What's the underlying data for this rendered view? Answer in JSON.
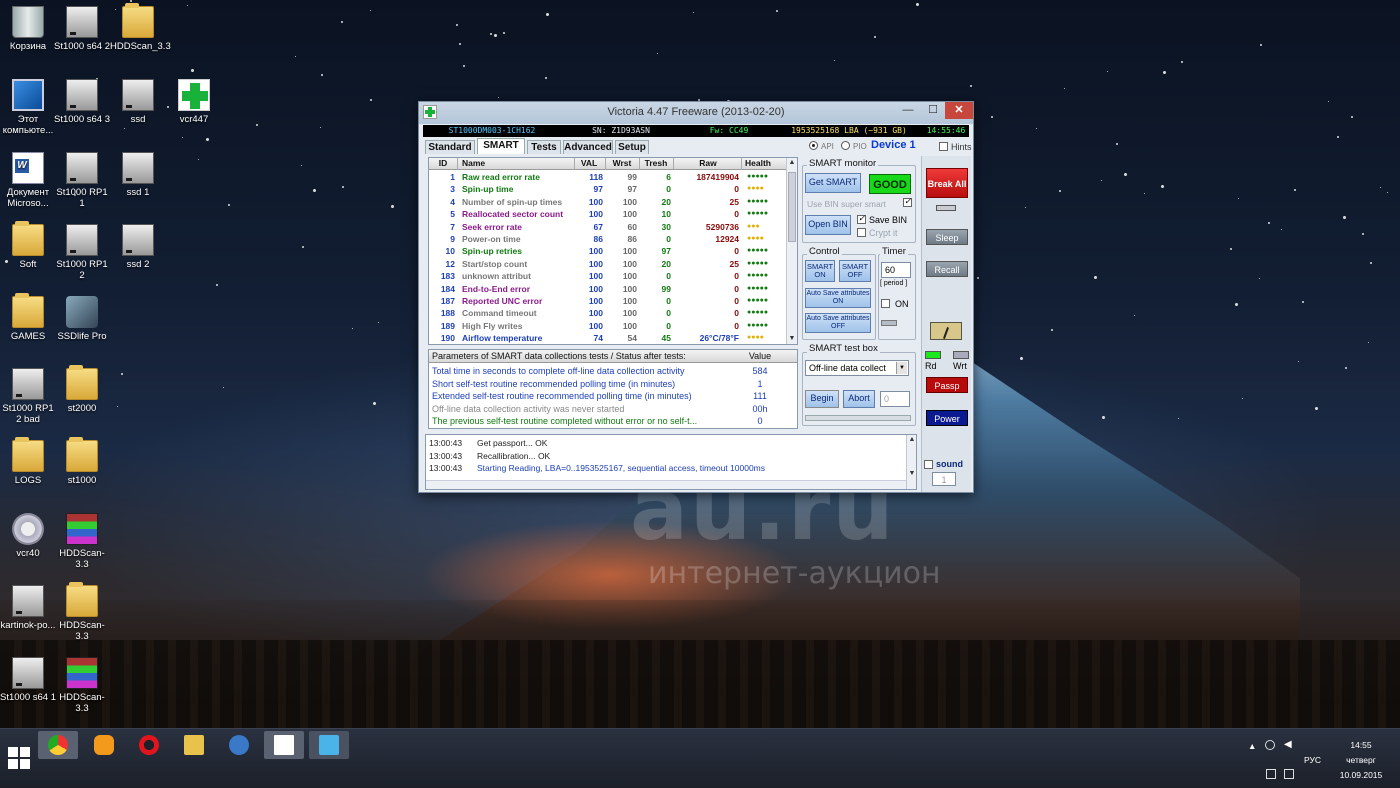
{
  "desktop": {
    "icons": [
      {
        "label": "Корзина",
        "icon": "recycle-bin-icon"
      },
      {
        "label": "St1000 s64 2",
        "icon": "drive-icon"
      },
      {
        "label": "HDDScan_3.3",
        "icon": "folder-icon"
      },
      {
        "label": "Этот компьюте...",
        "icon": "computer-icon"
      },
      {
        "label": "St1000 s64 3",
        "icon": "drive-icon"
      },
      {
        "label": "ssd",
        "icon": "drive-icon"
      },
      {
        "label": "vcr447",
        "icon": "victoria-icon"
      },
      {
        "label": "Документ Microso...",
        "icon": "word-document-icon"
      },
      {
        "label": "St1000 RP1 1",
        "icon": "drive-icon"
      },
      {
        "label": "ssd 1",
        "icon": "drive-icon"
      },
      {
        "label": "Soft",
        "icon": "folder-icon"
      },
      {
        "label": "St1000 RP1 2",
        "icon": "drive-icon"
      },
      {
        "label": "ssd 2",
        "icon": "drive-icon"
      },
      {
        "label": "GAMES",
        "icon": "folder-icon"
      },
      {
        "label": "SSDlife Pro",
        "icon": "ssdlife-icon"
      },
      {
        "label": "St1000 RP1 2 bad",
        "icon": "drive-icon"
      },
      {
        "label": "st2000",
        "icon": "folder-icon"
      },
      {
        "label": "LOGS",
        "icon": "folder-icon"
      },
      {
        "label": "st1000",
        "icon": "folder-icon"
      },
      {
        "label": "vcr40",
        "icon": "gear-icon"
      },
      {
        "label": "HDDScan-3.3",
        "icon": "winrar-icon"
      },
      {
        "label": "kartinok-po...",
        "icon": "drive-icon"
      },
      {
        "label": "HDDScan-3.3",
        "icon": "folder-icon"
      },
      {
        "label": "St1000 s64 1",
        "icon": "drive-icon"
      },
      {
        "label": "HDDScan-3.3",
        "icon": "winrar-icon"
      }
    ],
    "watermark_main": "au.ru",
    "watermark_sub": "интернет-аукцион"
  },
  "window": {
    "title": "Victoria 4.47  Freeware (2013-02-20)",
    "minimize": "—",
    "maximize": "☐",
    "close": "✕",
    "info": {
      "model": "ST1000DM003-1CH162",
      "serial": "SN: Z1D93ASN",
      "firmware": "Fw: CC49",
      "lba": "1953525168 LBA (~931 GB)",
      "time": "14:55:46"
    },
    "tabs": [
      "Standard",
      "SMART",
      "Tests",
      "Advanced",
      "Setup"
    ],
    "active_tab": "SMART",
    "api_label": "API",
    "pio_label": "PIO",
    "device_label": "Device 1",
    "hints_label": "Hints",
    "smart_table": {
      "headers": {
        "id": "ID",
        "name": "Name",
        "val": "VAL",
        "wrst": "Wrst",
        "tresh": "Tresh",
        "raw": "Raw",
        "health": "Health"
      },
      "rows": [
        {
          "id": "1",
          "name": "Raw read error rate",
          "val": "118",
          "wrst": "99",
          "tresh": "6",
          "raw": "187419904",
          "health": "●●●●●",
          "color": "#117a11"
        },
        {
          "id": "3",
          "name": "Spin-up time",
          "val": "97",
          "wrst": "97",
          "tresh": "0",
          "raw": "0",
          "health": "●●●●",
          "color": "#117a11"
        },
        {
          "id": "4",
          "name": "Number of spin-up times",
          "val": "100",
          "wrst": "100",
          "tresh": "20",
          "raw": "25",
          "health": "●●●●●",
          "color": "#777777"
        },
        {
          "id": "5",
          "name": "Reallocated sector count",
          "val": "100",
          "wrst": "100",
          "tresh": "10",
          "raw": "0",
          "health": "●●●●●",
          "color": "#8a1a8a"
        },
        {
          "id": "7",
          "name": "Seek error rate",
          "val": "67",
          "wrst": "60",
          "tresh": "30",
          "raw": "5290736",
          "health": "●●●",
          "color": "#8a1a8a"
        },
        {
          "id": "9",
          "name": "Power-on time",
          "val": "86",
          "wrst": "86",
          "tresh": "0",
          "raw": "12924",
          "health": "●●●●",
          "color": "#777777"
        },
        {
          "id": "10",
          "name": "Spin-up retries",
          "val": "100",
          "wrst": "100",
          "tresh": "97",
          "raw": "0",
          "health": "●●●●●",
          "color": "#117a11"
        },
        {
          "id": "12",
          "name": "Start/stop count",
          "val": "100",
          "wrst": "100",
          "tresh": "20",
          "raw": "25",
          "health": "●●●●●",
          "color": "#777777"
        },
        {
          "id": "183",
          "name": "unknown attribut",
          "val": "100",
          "wrst": "100",
          "tresh": "0",
          "raw": "0",
          "health": "●●●●●",
          "color": "#777777"
        },
        {
          "id": "184",
          "name": "End-to-End error",
          "val": "100",
          "wrst": "100",
          "tresh": "99",
          "raw": "0",
          "health": "●●●●●",
          "color": "#8a1a8a"
        },
        {
          "id": "187",
          "name": "Reported UNC error",
          "val": "100",
          "wrst": "100",
          "tresh": "0",
          "raw": "0",
          "health": "●●●●●",
          "color": "#8a1a8a"
        },
        {
          "id": "188",
          "name": "Command timeout",
          "val": "100",
          "wrst": "100",
          "tresh": "0",
          "raw": "0",
          "health": "●●●●●",
          "color": "#777777"
        },
        {
          "id": "189",
          "name": "High Fly writes",
          "val": "100",
          "wrst": "100",
          "tresh": "0",
          "raw": "0",
          "health": "●●●●●",
          "color": "#777777"
        },
        {
          "id": "190",
          "name": "Airflow temperature",
          "val": "74",
          "wrst": "54",
          "tresh": "45",
          "raw": "26°C/78°F",
          "health": "●●●●",
          "color": "#1d3fb8"
        }
      ]
    },
    "params": {
      "header": "Parameters of SMART data collections tests / Status after tests:",
      "value_header": "Value",
      "rows": [
        {
          "text": "Total time in seconds to complete off-line data collection activity",
          "value": "584",
          "color": "#1d3fb8"
        },
        {
          "text": "Short self-test routine recommended polling time (in minutes)",
          "value": "1",
          "color": "#1d3fb8"
        },
        {
          "text": "Extended self-test routine recommended polling time (in minutes)",
          "value": "111",
          "color": "#1d3fb8"
        },
        {
          "text": "Off-line data collection activity was never started",
          "value": "00h",
          "color": "#888888"
        },
        {
          "text": "The previous self-test routine completed without error or no self-t...",
          "value": "0",
          "color": "#117a11"
        }
      ]
    },
    "log": [
      {
        "time": "13:00:43",
        "msg": "Get passport... OK",
        "blue": false
      },
      {
        "time": "13:00:43",
        "msg": "Recallibration... OK",
        "blue": false
      },
      {
        "time": "13:00:43",
        "msg": "Starting Reading, LBA=0..1953525167, sequential access, timeout 10000ms",
        "blue": true
      }
    ],
    "smart_monitor": {
      "label": "SMART monitor",
      "get_smart": "Get SMART",
      "status": "GOOD",
      "use_bin": "Use BIN super smart",
      "open_bin": "Open BIN",
      "save_bin": "Save BIN",
      "crypt": "Crypt it"
    },
    "control": {
      "label": "Control",
      "smart_on": "SMART ON",
      "smart_off": "SMART OFF",
      "autosave_on": "Auto Save attributes ON",
      "autosave_off": "Auto Save attributes OFF"
    },
    "timer": {
      "label": "Timer",
      "value": "60",
      "period": "[ period ]",
      "on": "ON"
    },
    "test_box": {
      "label": "SMART test box",
      "selected": "Off-line data collect",
      "begin": "Begin",
      "abort": "Abort",
      "counter": "0"
    },
    "right_strip": {
      "break_all": "Break All",
      "sleep": "Sleep",
      "recall": "Recall",
      "rd": "Rd",
      "wrt": "Wrt",
      "passp": "Passp",
      "power": "Power",
      "sound": "sound",
      "spinner": "1"
    },
    "colors": {
      "good": "#18d81a",
      "break": "#e01e1e",
      "power": "#0c1a92"
    }
  },
  "taskbar": {
    "apps": [
      "chrome-icon",
      "file-transfer-icon",
      "opera-icon",
      "file-explorer-icon",
      "qbittorrent-icon",
      "victoria-icon",
      "remote-desktop-icon"
    ],
    "language": "РУС",
    "clock_time": "14:55",
    "clock_day": "четверг",
    "clock_date": "10.09.2015"
  }
}
